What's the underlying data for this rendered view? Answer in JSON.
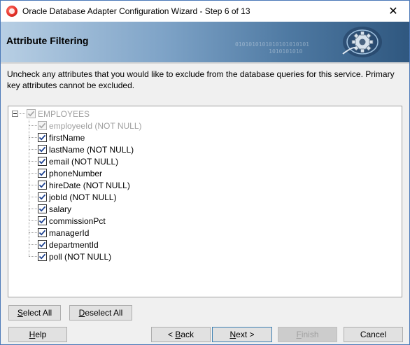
{
  "window": {
    "title": "Oracle Database Adapter Configuration Wizard - Step 6 of 13",
    "close_glyph": "✕"
  },
  "banner": {
    "title": "Attribute Filtering",
    "binary_text": "0101010101010101010101\n          1010101010"
  },
  "instructions": "Uncheck any attributes that you would like to exclude from the database queries for this service.  Primary key attributes cannot be excluded.",
  "tree": {
    "root": {
      "label": "EMPLOYEES",
      "checked": true,
      "disabled": true,
      "expanded": true
    },
    "items": [
      {
        "label": "employeeId (NOT NULL)",
        "checked": true,
        "disabled": true
      },
      {
        "label": "firstName",
        "checked": true,
        "disabled": false
      },
      {
        "label": "lastName (NOT NULL)",
        "checked": true,
        "disabled": false
      },
      {
        "label": "email (NOT NULL)",
        "checked": true,
        "disabled": false
      },
      {
        "label": "phoneNumber",
        "checked": true,
        "disabled": false
      },
      {
        "label": "hireDate (NOT NULL)",
        "checked": true,
        "disabled": false
      },
      {
        "label": "jobId (NOT NULL)",
        "checked": true,
        "disabled": false
      },
      {
        "label": "salary",
        "checked": true,
        "disabled": false
      },
      {
        "label": "commissionPct",
        "checked": true,
        "disabled": false
      },
      {
        "label": "managerId",
        "checked": true,
        "disabled": false
      },
      {
        "label": "departmentId",
        "checked": true,
        "disabled": false
      },
      {
        "label": "poll (NOT NULL)",
        "checked": true,
        "disabled": false
      }
    ]
  },
  "buttons": {
    "select_all": {
      "mnemonic": "S",
      "rest": "elect All"
    },
    "deselect_all": {
      "mnemonic": "D",
      "rest": "eselect All"
    },
    "help": {
      "mnemonic": "H",
      "rest": "elp"
    },
    "back": {
      "prefix": "< ",
      "mnemonic": "B",
      "rest": "ack"
    },
    "next": {
      "mnemonic": "N",
      "rest": "ext >"
    },
    "finish": {
      "mnemonic": "F",
      "rest": "inish"
    },
    "cancel": {
      "label": "Cancel"
    }
  },
  "colors": {
    "checkmark": "#1a3f8f",
    "checkmark_disabled": "#a8a8a8"
  }
}
